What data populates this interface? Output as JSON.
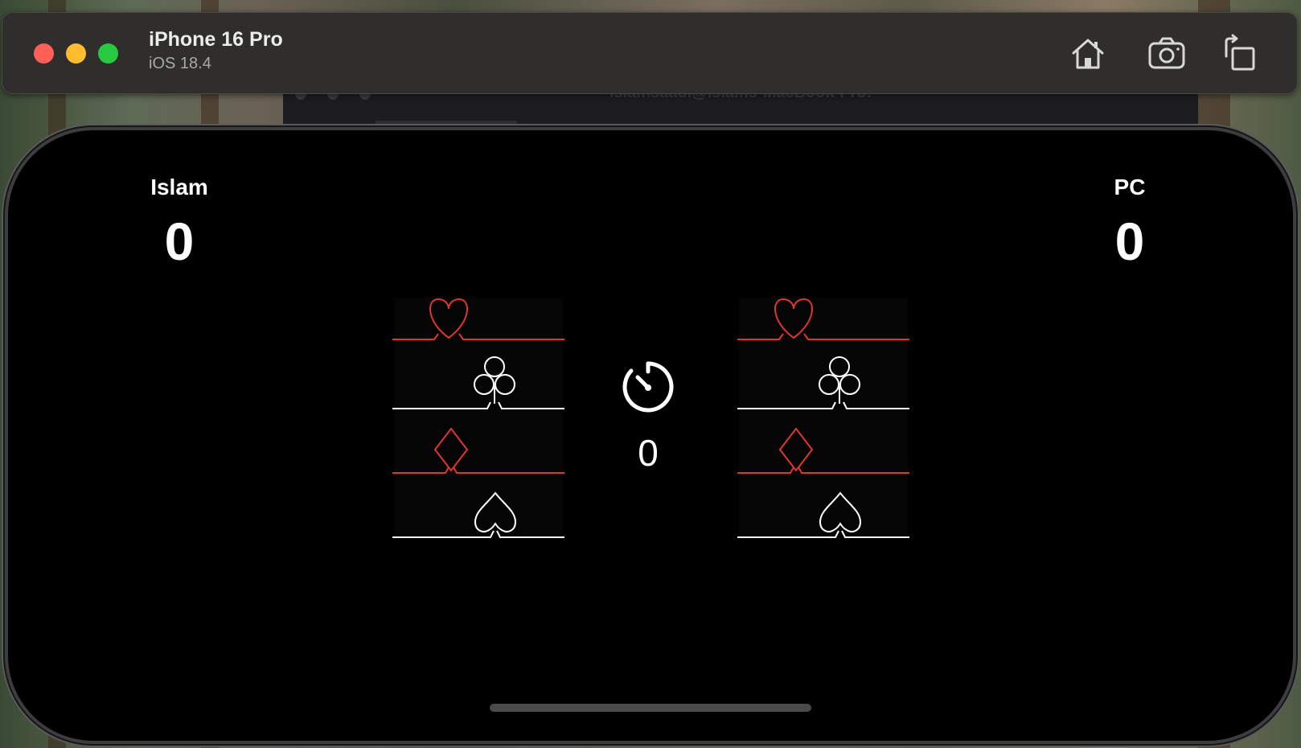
{
  "simulator": {
    "device_name": "iPhone 16 Pro",
    "os_version": "iOS 18.4",
    "background_window_title": "islamsaadi@Islams-MacBook-Pro:",
    "toolbar": [
      {
        "icon": "home-icon",
        "label": "Home"
      },
      {
        "icon": "camera-icon",
        "label": "Screenshot"
      },
      {
        "icon": "rotate-icon",
        "label": "Rotate"
      }
    ]
  },
  "game": {
    "player": {
      "name": "Islam",
      "score": "0"
    },
    "opponent": {
      "name": "PC",
      "score": "0"
    },
    "timer": {
      "icon": "timer-icon",
      "value": "0"
    },
    "cards": [
      {
        "owner": "player",
        "suits": [
          "heart-icon",
          "club-icon",
          "diamond-icon",
          "spade-icon"
        ]
      },
      {
        "owner": "opponent",
        "suits": [
          "heart-icon",
          "club-icon",
          "diamond-icon",
          "spade-icon"
        ]
      }
    ]
  },
  "colors": {
    "red_suit": "#e0362c",
    "black_suit": "#ffffff",
    "screen_background": "#000000"
  }
}
